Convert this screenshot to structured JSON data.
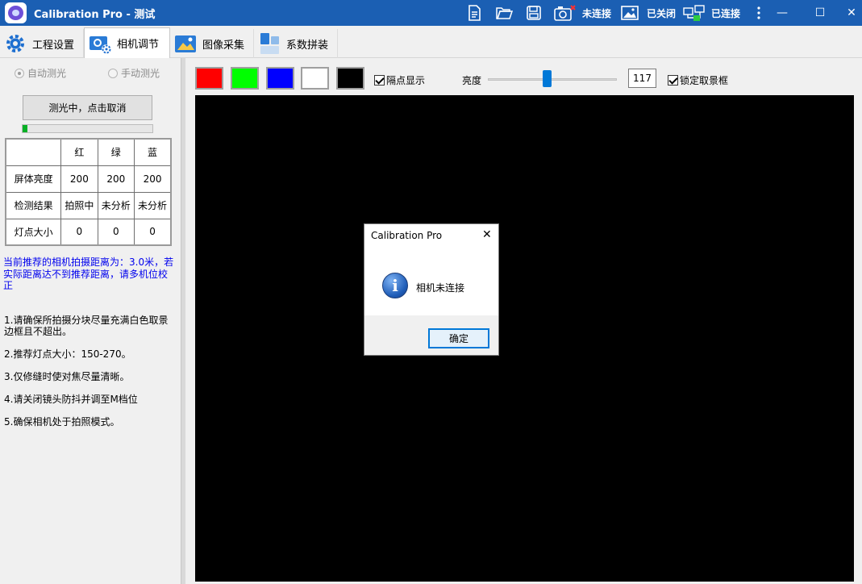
{
  "window": {
    "title": "Calibration Pro - 测试",
    "status_camera": "未连接",
    "status_image": "已关闭",
    "status_network": "已连接",
    "minimize": "—",
    "maximize": "☐",
    "close": "✕"
  },
  "tabs": [
    {
      "label": "工程设置"
    },
    {
      "label": "相机调节"
    },
    {
      "label": "图像采集"
    },
    {
      "label": "系数拼装"
    }
  ],
  "left_panel": {
    "radio_auto": "自动测光",
    "radio_manual": "手动测光",
    "cancel_button": "测光中，点击取消",
    "progress_percent": 4,
    "table": {
      "headers": [
        "",
        "红",
        "绿",
        "蓝"
      ],
      "rows": [
        [
          "屏体亮度",
          "200",
          "200",
          "200"
        ],
        [
          "检测结果",
          "拍照中",
          "未分析",
          "未分析"
        ],
        [
          "灯点大小",
          "0",
          "0",
          "0"
        ]
      ]
    },
    "recommendation": "当前推荐的相机拍摄距离为：3.0米，若实际距离达不到推荐距离，请多机位校正",
    "tips": [
      "1.请确保所拍摄分块尽量充满白色取景边框且不超出。",
      "2.推荐灯点大小：150-270。",
      "3.仅修缝时使对焦尽量清晰。",
      "4.请关闭镜头防抖并调至M档位",
      "5.确保相机处于拍照模式。"
    ]
  },
  "toolbar": {
    "swatches": [
      "#ff0000",
      "#00ff00",
      "#0000ff",
      "#ffffff",
      "#000000"
    ],
    "dot_display": "隔点显示",
    "brightness_label": "亮度",
    "brightness_value": "117",
    "brightness_fraction": 0.46,
    "lock_frame": "锁定取景框"
  },
  "dialog": {
    "title": "Calibration Pro",
    "close": "✕",
    "info_glyph": "i",
    "message": "相机未连接",
    "ok": "确定"
  }
}
